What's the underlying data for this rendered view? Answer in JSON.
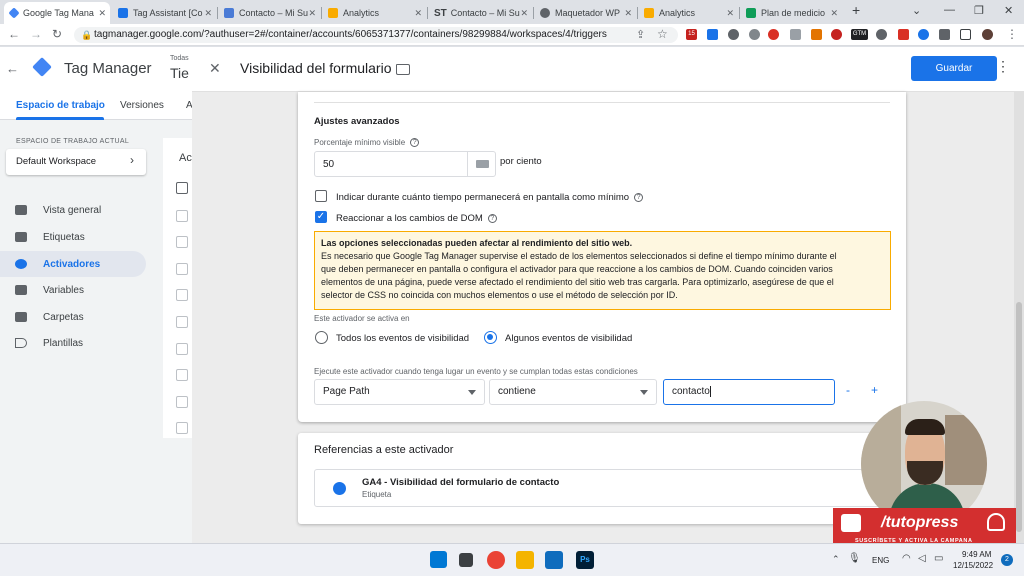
{
  "browser": {
    "tabs": [
      {
        "label": "Google Tag Mana",
        "color": "#4285f4",
        "active": true
      },
      {
        "label": "Tag Assistant [Co",
        "color": "#1a73e8"
      },
      {
        "label": "Contacto – Mi Su",
        "color": "#4a7bd6"
      },
      {
        "label": "Analytics",
        "color": "#f9ab00"
      },
      {
        "label": "Contacto – Mi Su",
        "color": "#202124",
        "prefix": "ST"
      },
      {
        "label": "Maquetador WP",
        "color": "#5f6368"
      },
      {
        "label": "Analytics",
        "color": "#f9ab00"
      },
      {
        "label": "Plan de medicio",
        "color": "#0f9d58"
      }
    ],
    "url": "tagmanager.google.com/?authuser=2#/container/accounts/6065371377/containers/98299884/workspaces/4/triggers",
    "ext_badges": {
      "mail": "15",
      "gtm": "GTM"
    }
  },
  "gtm": {
    "app_name": "Tag Manager",
    "account_line1": "Todas",
    "account_line2": "Tie",
    "nav_tabs": [
      "Espacio de trabajo",
      "Versiones",
      "A"
    ],
    "workspace_label": "ESPACIO DE TRABAJO ACTUAL",
    "workspace_name": "Default Workspace",
    "nav": [
      "Vista general",
      "Etiquetas",
      "Activadores",
      "Variables",
      "Carpetas",
      "Plantillas"
    ],
    "list_header": "Ac"
  },
  "panel": {
    "title": "Visibilidad del formulario",
    "save": "Guardar",
    "advanced_title": "Ajustes avanzados",
    "min_pct_label": "Porcentaje mínimo visible",
    "min_pct_value": "50",
    "pct_suffix": "por ciento",
    "check_time": "Indicar durante cuánto tiempo permanecerá en pantalla como mínimo",
    "check_dom": "Reaccionar a los cambios de DOM",
    "warn_title": "Las opciones seleccionadas pueden afectar al rendimiento del sitio web.",
    "warn_l1": "Es necesario que Google Tag Manager supervise el estado de los elementos seleccionados si define el tiempo mínimo durante el",
    "warn_l2": "que deben permanecer en pantalla o configura el activador para que reaccione a los cambios de DOM. Cuando coinciden varios",
    "warn_l3": "elementos de una página, puede verse afectado el rendimiento del sitio web tras cargarla. Para optimizarlo, asegúrese de que el",
    "warn_l4": "selector de CSS no coincida con muchos elementos o use el método de selección por ID.",
    "fires_on_label": "Este activador se activa en",
    "radio_all": "Todos los eventos de visibilidad",
    "radio_some": "Algunos eventos de visibilidad",
    "cond_label": "Ejecute este activador cuando tenga lugar un evento y se cumplan todas estas condiciones",
    "cond_var": "Page Path",
    "cond_op": "contiene",
    "cond_value": "contacto",
    "minus": "-",
    "plus": "+",
    "refs_title": "Referencias a este activador",
    "ref_name": "GA4 - Visibilidad del formulario de contacto",
    "ref_type": "Etiqueta"
  },
  "overlay": {
    "brand": "/tutopress",
    "cta": "SUSCRÍBETE Y ACTIVA LA CAMPANA",
    "brand_color": "#d32f2f"
  },
  "taskbar": {
    "lang": "ENG",
    "time": "9:49 AM",
    "date": "12/15/2022",
    "notif": "2"
  }
}
